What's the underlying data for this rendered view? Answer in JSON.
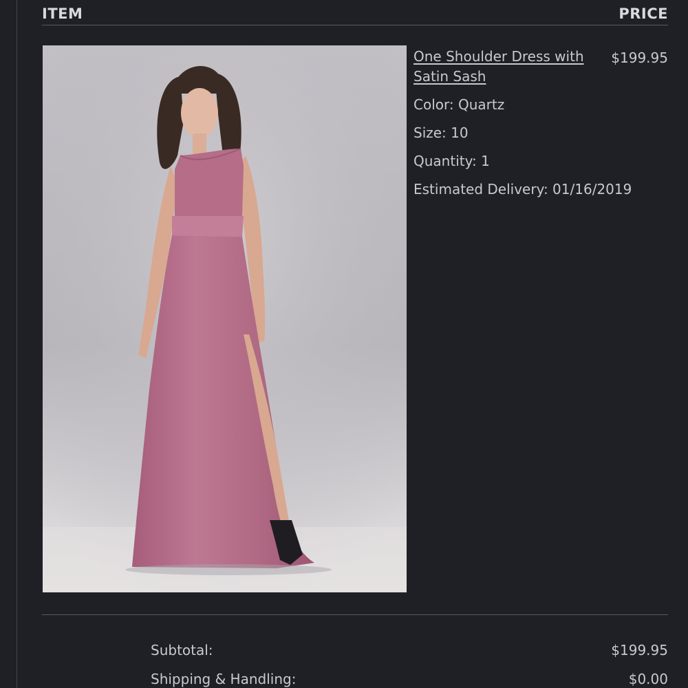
{
  "header": {
    "item_label": "ITEM",
    "price_label": "PRICE"
  },
  "product": {
    "name": "One Shoulder Dress with Satin Sash",
    "price": "$199.95",
    "color": "Color: Quartz",
    "size": "Size: 10",
    "quantity": "Quantity: 1",
    "delivery": "Estimated Delivery: 01/16/2019"
  },
  "summary": {
    "subtotal_label": "Subtotal:",
    "subtotal_value": "$199.95",
    "shipping_label": "Shipping & Handling:",
    "shipping_value": "$0.00"
  },
  "colors": {
    "background": "#1f2026",
    "text": "#c9c9cf",
    "dress": "#b56d88"
  }
}
